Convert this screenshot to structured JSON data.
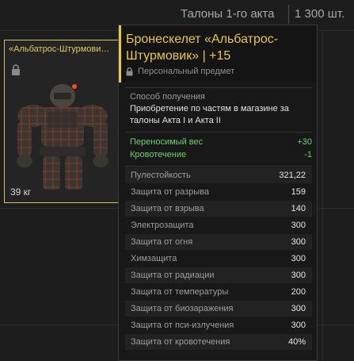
{
  "topbar": {
    "currency_label": "Талоны 1-го акта",
    "currency_value": "1 300 шт."
  },
  "item_card": {
    "title": "«Альбатрос-Штурмови…",
    "weight": "39 кг"
  },
  "tooltip": {
    "name": "Бронескелет «Альбатрос-Штурмовик» | +15",
    "personal_label": "Персональный предмет",
    "source_label": "Способ получения",
    "source_text": "Приобретение по частям в магазине за талоны Акта I и Акта II",
    "modifiers": [
      {
        "label": "Переносимый вес",
        "value": "+30"
      },
      {
        "label": "Кровотечение",
        "value": "-1"
      }
    ],
    "stats": [
      {
        "label": "Пулестойкость",
        "value": "321,22"
      },
      {
        "label": "Защита от разрыва",
        "value": "159"
      },
      {
        "label": "Защита от взрыва",
        "value": "140"
      },
      {
        "label": "Электрозащита",
        "value": "300"
      },
      {
        "label": "Защита от огня",
        "value": "300"
      },
      {
        "label": "Химзащита",
        "value": "300"
      },
      {
        "label": "Защита от радиации",
        "value": "300"
      },
      {
        "label": "Защита от температуры",
        "value": "200"
      },
      {
        "label": "Защита от биозаражения",
        "value": "300"
      },
      {
        "label": "Защита от пси-излучения",
        "value": "300"
      },
      {
        "label": "Защита от кровотечения",
        "value": "40%"
      }
    ]
  },
  "colors": {
    "accent": "#e8c84a",
    "positive": "#6fd06f",
    "background": "#1d1d1d"
  }
}
